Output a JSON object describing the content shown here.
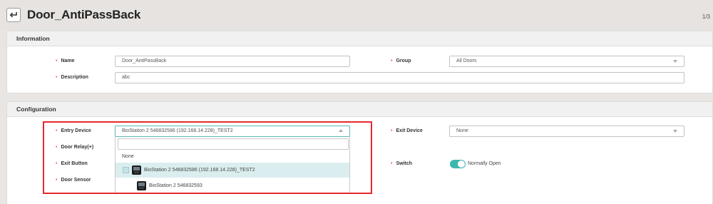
{
  "header": {
    "title": "Door_AntiPassBack",
    "pager": "1/3",
    "back_icon": "return-arrow-icon"
  },
  "information": {
    "section_title": "Information",
    "name": {
      "label": "Name",
      "value": "Door_AntiPassBack"
    },
    "group": {
      "label": "Group",
      "value": "All Doors"
    },
    "description": {
      "label": "Description",
      "value": "abc"
    }
  },
  "configuration": {
    "section_title": "Configuration",
    "entry_device": {
      "label": "Entry Device",
      "value": "BioStation 2 546832586 (192.168.14.228)_TEST2"
    },
    "exit_device": {
      "label": "Exit Device",
      "value": "None"
    },
    "door_relay": {
      "label": "Door Relay(+)"
    },
    "exit_button": {
      "label": "Exit Button"
    },
    "door_sensor": {
      "label": "Door Sensor"
    },
    "switch": {
      "label": "Switch",
      "state": "on",
      "text": "Normally Open"
    },
    "dropdown": {
      "search_value": "",
      "options": [
        {
          "label": "None"
        },
        {
          "label": "BioStation 2 546832586 (192.168.14.228)_TEST2",
          "highlighted": true
        },
        {
          "label": "BioStation 2 546832593"
        }
      ]
    }
  },
  "colors": {
    "accent": "#3fb6ad",
    "required": "#e2544b",
    "annotation": "#e52a2f",
    "highlight_row": "#dbeeef"
  }
}
